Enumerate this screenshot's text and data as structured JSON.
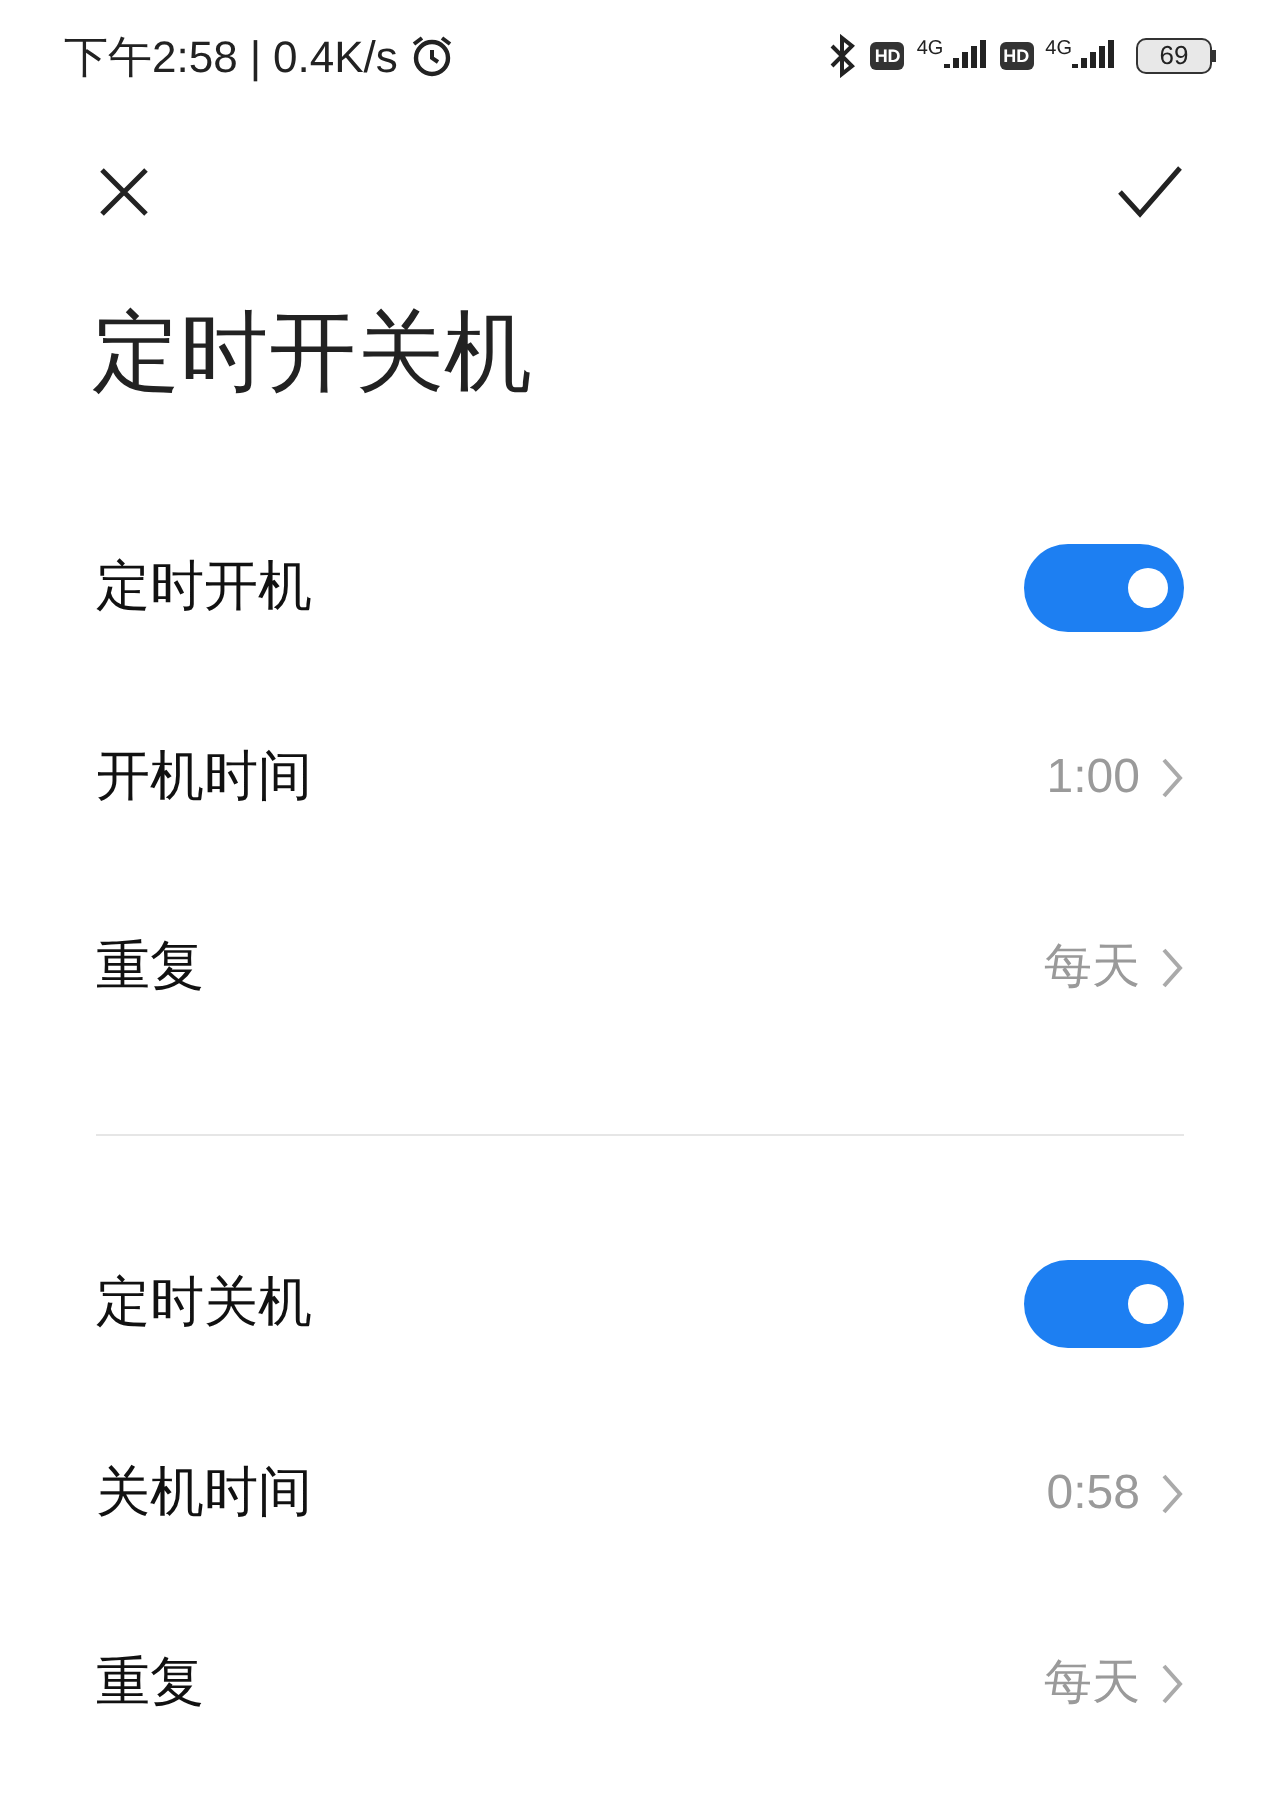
{
  "status_bar": {
    "time": "下午2:58",
    "separator": "|",
    "speed": "0.4K/s",
    "hd_badges": [
      "HD",
      "HD"
    ],
    "networks": [
      "4G",
      "4G"
    ],
    "battery": "69"
  },
  "title": "定时开关机",
  "sections": [
    {
      "rows": [
        {
          "kind": "toggle",
          "label": "定时开机",
          "on": true
        },
        {
          "kind": "value",
          "label": "开机时间",
          "value": "1:00"
        },
        {
          "kind": "value",
          "label": "重复",
          "value": "每天"
        }
      ]
    },
    {
      "rows": [
        {
          "kind": "toggle",
          "label": "定时关机",
          "on": true
        },
        {
          "kind": "value",
          "label": "关机时间",
          "value": "0:58"
        },
        {
          "kind": "value",
          "label": "重复",
          "value": "每天"
        }
      ]
    }
  ]
}
